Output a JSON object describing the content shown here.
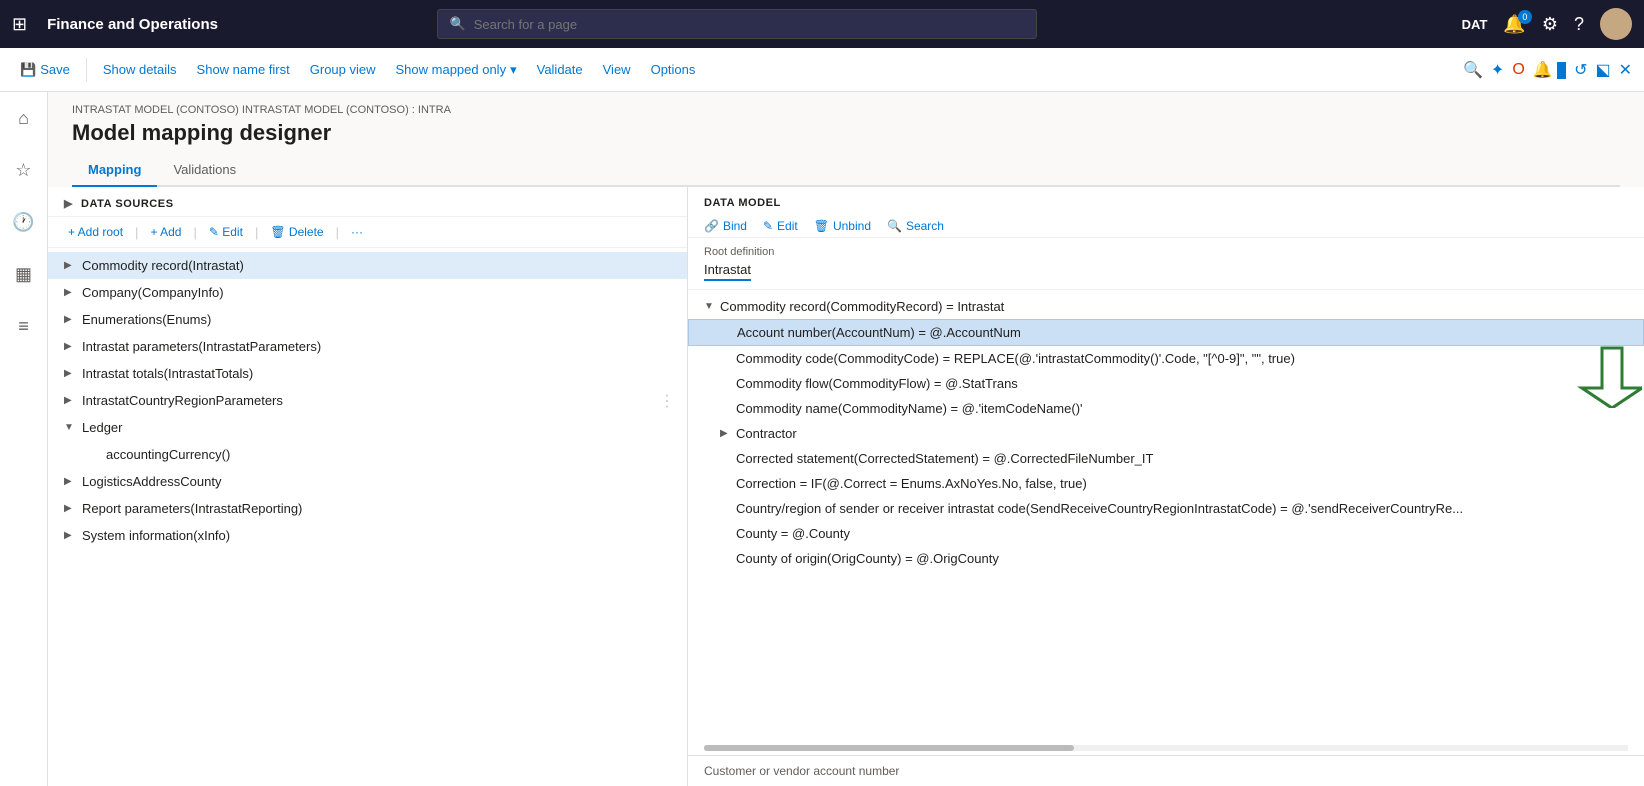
{
  "topnav": {
    "waffle": "⊞",
    "app_title": "Finance and Operations",
    "search_placeholder": "Search for a page",
    "env": "DAT",
    "notification_count": "0"
  },
  "toolbar": {
    "save_label": "Save",
    "show_details_label": "Show details",
    "show_name_first_label": "Show name first",
    "group_view_label": "Group view",
    "show_mapped_only_label": "Show mapped only",
    "validate_label": "Validate",
    "view_label": "View",
    "options_label": "Options"
  },
  "breadcrumb": "INTRASTAT MODEL (CONTOSO) INTRASTAT MODEL (CONTOSO) : INTRA",
  "page_title": "Model mapping designer",
  "tabs": [
    {
      "label": "Mapping",
      "active": true
    },
    {
      "label": "Validations",
      "active": false
    }
  ],
  "datasources_panel": {
    "header": "DATA SOURCES",
    "toolbar_items": [
      {
        "label": "+ Add root"
      },
      {
        "label": "+ Add"
      },
      {
        "label": "✎ Edit"
      },
      {
        "label": "🗑 Delete"
      },
      {
        "label": "···"
      }
    ],
    "tree_items": [
      {
        "label": "Commodity record(Intrastat)",
        "indent": 0,
        "has_children": true,
        "selected": true,
        "expanded": false
      },
      {
        "label": "Company(CompanyInfo)",
        "indent": 0,
        "has_children": true,
        "selected": false,
        "expanded": false
      },
      {
        "label": "Enumerations(Enums)",
        "indent": 0,
        "has_children": true,
        "selected": false,
        "expanded": false
      },
      {
        "label": "Intrastat parameters(IntrastatParameters)",
        "indent": 0,
        "has_children": true,
        "selected": false,
        "expanded": false
      },
      {
        "label": "Intrastat totals(IntrastatTotals)",
        "indent": 0,
        "has_children": true,
        "selected": false,
        "expanded": false
      },
      {
        "label": "IntrastatCountryRegionParameters",
        "indent": 0,
        "has_children": true,
        "selected": false,
        "expanded": false
      },
      {
        "label": "Ledger",
        "indent": 0,
        "has_children": true,
        "selected": false,
        "expanded": true
      },
      {
        "label": "accountingCurrency()",
        "indent": 1,
        "has_children": false,
        "selected": false,
        "expanded": false
      },
      {
        "label": "LogisticsAddressCounty",
        "indent": 0,
        "has_children": true,
        "selected": false,
        "expanded": false
      },
      {
        "label": "Report parameters(IntrastatReporting)",
        "indent": 0,
        "has_children": true,
        "selected": false,
        "expanded": false
      },
      {
        "label": "System information(xInfo)",
        "indent": 0,
        "has_children": true,
        "selected": false,
        "expanded": false
      }
    ]
  },
  "datamodel_panel": {
    "header": "DATA MODEL",
    "toolbar_items": [
      {
        "label": "Bind",
        "icon": "🔗"
      },
      {
        "label": "Edit",
        "icon": "✎"
      },
      {
        "label": "Unbind",
        "icon": "🗑"
      },
      {
        "label": "Search",
        "icon": "🔍"
      }
    ],
    "root_definition_label": "Root definition",
    "root_definition_value": "Intrastat",
    "model_items": [
      {
        "label": "Commodity record(CommodityRecord) = Intrastat",
        "indent": 0,
        "expanded": true,
        "selected": false
      },
      {
        "label": "Account number(AccountNum) = @.AccountNum",
        "indent": 1,
        "selected": true
      },
      {
        "label": "Commodity code(CommodityCode) = REPLACE(@.'intrastatCommodity()'.Code, \"[^0-9]\", \"\", true)",
        "indent": 1,
        "selected": false
      },
      {
        "label": "Commodity flow(CommodityFlow) = @.StatTrans",
        "indent": 1,
        "selected": false
      },
      {
        "label": "Commodity name(CommodityName) = @.'itemCodeName()'",
        "indent": 1,
        "selected": false
      },
      {
        "label": "Contractor",
        "indent": 1,
        "has_children": true,
        "selected": false
      },
      {
        "label": "Corrected statement(CorrectedStatement) = @.CorrectedFileNumber_IT",
        "indent": 1,
        "selected": false
      },
      {
        "label": "Correction = IF(@.Correct = Enums.AxNoYes.No, false, true)",
        "indent": 1,
        "selected": false
      },
      {
        "label": "Country/region of sender or receiver intrastat code(SendReceiveCountryRegionIntrastatCode) = @.'sendReceiverCountryRe...",
        "indent": 1,
        "selected": false
      },
      {
        "label": "County = @.County",
        "indent": 1,
        "selected": false
      },
      {
        "label": "County of origin(OrigCounty) = @.OrigCounty",
        "indent": 1,
        "selected": false
      }
    ]
  },
  "bottom_label": "Customer or vendor account number"
}
